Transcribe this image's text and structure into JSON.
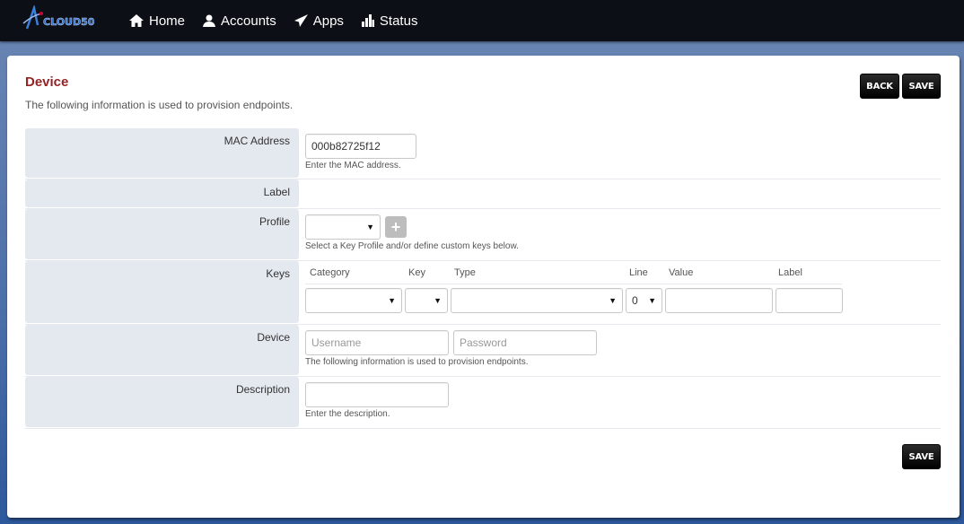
{
  "brand": {
    "logo_text": "CLOUD50"
  },
  "nav": [
    {
      "label": "Home",
      "icon": "home-icon"
    },
    {
      "label": "Accounts",
      "icon": "user-icon"
    },
    {
      "label": "Apps",
      "icon": "paper-plane-icon"
    },
    {
      "label": "Status",
      "icon": "bar-chart-icon"
    }
  ],
  "page": {
    "title": "Device",
    "subtitle": "The following information is used to provision endpoints.",
    "back_label": "BACK",
    "save_label": "SAVE",
    "save_bottom_label": "SAVE"
  },
  "form": {
    "mac": {
      "label": "MAC Address",
      "value": "000b82725f12",
      "help": "Enter the MAC address."
    },
    "label": {
      "label": "Label"
    },
    "profile": {
      "label": "Profile",
      "value": "",
      "help": "Select a Key Profile and/or define custom keys below."
    },
    "keys": {
      "label": "Keys",
      "headers": {
        "category": "Category",
        "key": "Key",
        "type": "Type",
        "line": "Line",
        "value": "Value",
        "label": "Label"
      },
      "row": {
        "category": "",
        "key": "",
        "type": "",
        "line": "0",
        "value": "",
        "label": ""
      }
    },
    "device": {
      "label": "Device",
      "username_placeholder": "Username",
      "password_placeholder": "Password",
      "help": "The following information is used to provision endpoints."
    },
    "description": {
      "label": "Description",
      "value": "",
      "help": "Enter the description."
    }
  }
}
